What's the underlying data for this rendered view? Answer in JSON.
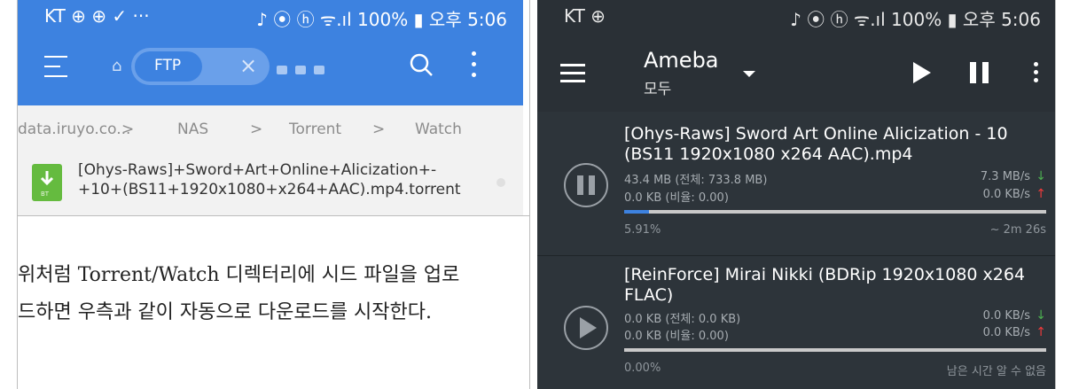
{
  "left_screen": {
    "status_bar": {
      "carrier": "KT ⊕ ⊕ ✓ ···",
      "indicators": "♪ ⦿ ⓗ ᯤ.ıl 100% ▮ 오후 5:06"
    },
    "toolbar": {
      "tab_label": "FTP",
      "icons": [
        "menu-icon",
        "home-icon",
        "router-icon",
        "close-icon",
        "search-icon",
        "more-icon"
      ],
      "accent": "#3d82e0"
    },
    "breadcrumb": [
      "data.iruyo.co...",
      "NAS",
      "Torrent",
      "Watch"
    ],
    "breadcrumb_sep": ">",
    "file": {
      "name_line1": "[Ohys-Raws]+Sword+Art+Online+Alicization+-",
      "name_line2": "+10+(BS11+1920x1080+x264+AAC).mp4.torrent",
      "icon_label": "BT",
      "icon_color": "#65bb3f"
    }
  },
  "caption": {
    "line1": "위처럼 Torrent/Watch 디렉터리에 시드 파일을 업로",
    "line2": "드하면 우측과 같이 자동으로 다운로드를 시작한다."
  },
  "right_screen": {
    "status_bar": {
      "carrier": "KT ⊕",
      "indicators": "♪ ⦿ ⓗ ᯤ.ıl 100% ▮ 오후 5:06"
    },
    "toolbar": {
      "title": "Ameba",
      "subtitle": "모두",
      "icons": [
        "menu-icon",
        "dropdown-icon",
        "play-icon",
        "pause-icon",
        "more-icon"
      ]
    },
    "torrents": [
      {
        "name": "[Ohys-Raws] Sword Art Online Alicization - 10 (BS11 1920x1080 x264 AAC).mp4",
        "size_line": "43.4 MB (전체: 733.8 MB)",
        "ratio_line": "0.0 KB (비율: 0.00)",
        "down_rate": "7.3 MB/s",
        "up_rate": "0.0 KB/s",
        "progress_text": "5.91%",
        "progress": 0.0591,
        "eta": "~ 2m 26s",
        "state": "pause"
      },
      {
        "name": "[ReinForce] Mirai Nikki (BDRip 1920x1080 x264 FLAC)",
        "size_line": "0.0 KB (전체: 0.0 KB)",
        "ratio_line": "0.0 KB (비율: 0.00)",
        "down_rate": "0.0 KB/s",
        "up_rate": "0.0 KB/s",
        "progress_text": "0.00%",
        "progress": 0.0,
        "eta": "남은 시간 알 수 없음",
        "state": "play"
      }
    ],
    "arrows": {
      "down": "↓",
      "up": "↑",
      "down_color": "#4caf50",
      "up_color": "#ef3b3b"
    },
    "progress_color": "#3d82e0"
  }
}
